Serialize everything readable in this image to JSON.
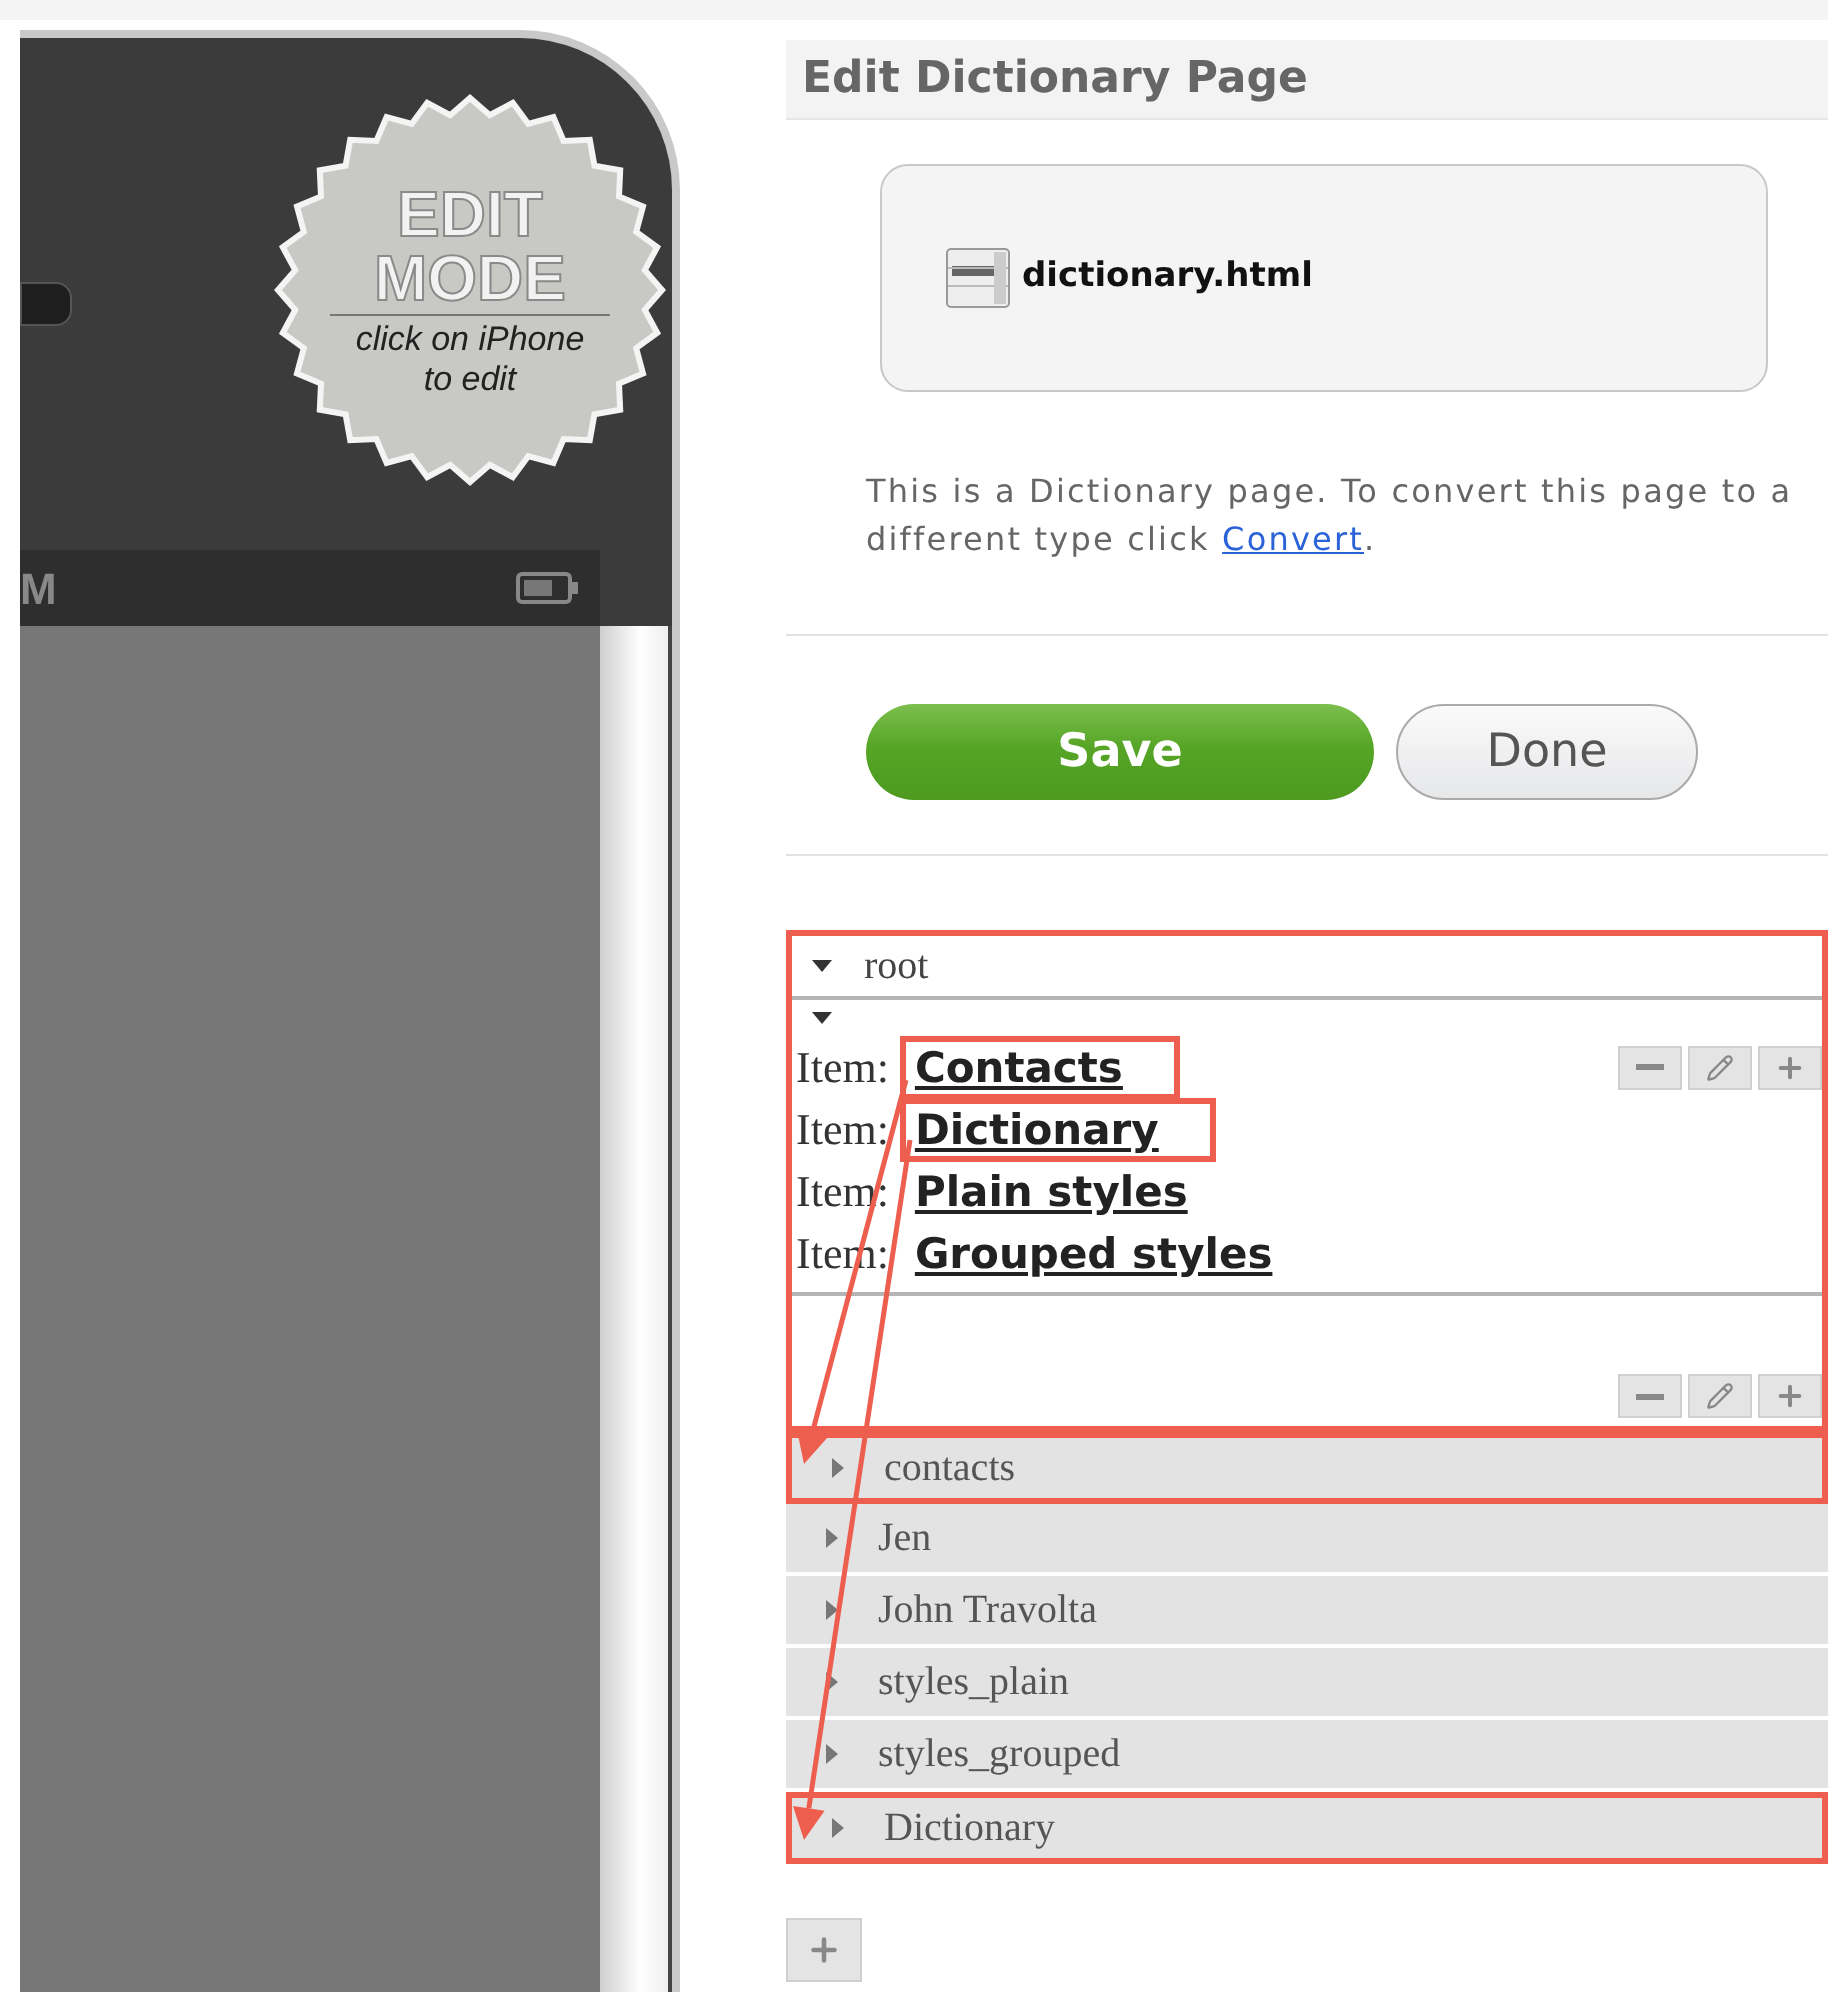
{
  "page_title": "Edit Dictionary Page",
  "phone": {
    "badge_lines": [
      "EDIT",
      "MODE"
    ],
    "badge_hint": "click on iPhone to edit",
    "status_text": "M"
  },
  "file": {
    "name": "dictionary.html"
  },
  "description": {
    "text": "This is a Dictionary page. To convert this page to a different type click ",
    "link": "Convert",
    "after": "."
  },
  "buttons": [
    {
      "label": "Save",
      "kind": "primary"
    },
    {
      "label": "Done",
      "kind": "secondary"
    }
  ],
  "tree": {
    "root": {
      "label": "root",
      "expanded": true,
      "highlighted": true
    },
    "list": {
      "expanded": true,
      "items": [
        {
          "prefix": "Item:",
          "value": "Contacts",
          "highlighted": true
        },
        {
          "prefix": "Item:",
          "value": "Dictionary",
          "highlighted": true
        },
        {
          "prefix": "Item:",
          "value": "Plain styles",
          "highlighted": false
        },
        {
          "prefix": "Item:",
          "value": "Grouped styles",
          "highlighted": false
        }
      ]
    },
    "rows": [
      {
        "label": "contacts",
        "expanded": false,
        "highlighted": true
      },
      {
        "label": "Jen",
        "expanded": false,
        "highlighted": false
      },
      {
        "label": "John Travolta",
        "expanded": false,
        "highlighted": false
      },
      {
        "label": "styles_plain",
        "expanded": false,
        "highlighted": false
      },
      {
        "label": "styles_grouped",
        "expanded": false,
        "highlighted": false
      },
      {
        "label": "Dictionary",
        "expanded": false,
        "highlighted": true
      }
    ]
  }
}
